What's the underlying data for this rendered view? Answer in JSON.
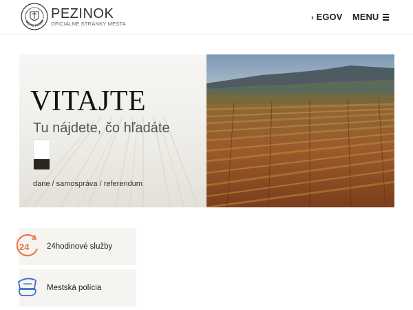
{
  "header": {
    "brand_name": "PEZINOK",
    "brand_sub": "OFICIÁLNE STRÁNKY MESTA",
    "seal_text": "MESTO PEZINOK",
    "egov_chevron": "›",
    "egov_label": "EGOV",
    "menu_label": "MENU"
  },
  "hero": {
    "title": "VITAJTE",
    "subtitle": "Tu nájdete, čo hľadáte",
    "links": "dane / samospráva / referendum"
  },
  "cards": [
    {
      "label": "24hodinové služby",
      "icon": "24h-service-icon",
      "icon_text": "24"
    },
    {
      "label": "Mestská polícia",
      "icon": "police-cap-icon"
    }
  ],
  "colors": {
    "accent": "#e8784a",
    "accent_blue": "#3b6fc4",
    "card_bg": "#f6f4f1",
    "search_button": "#2a2620"
  }
}
